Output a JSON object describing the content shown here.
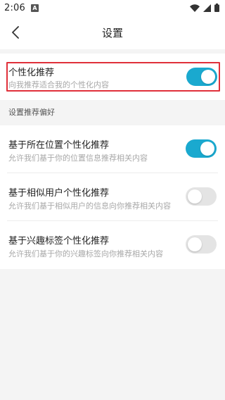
{
  "status_bar": {
    "time": "2:06",
    "notification_letter": "A"
  },
  "header": {
    "title": "设置"
  },
  "top_setting": {
    "title": "个性化推荐",
    "description": "向我推荐适合我的个性化内容",
    "enabled": true
  },
  "section": {
    "label": "设置推荐偏好"
  },
  "preferences": [
    {
      "title": "基于所在位置个性化推荐",
      "description": "允许我们基于你的位置信息推荐相关内容",
      "enabled": true
    },
    {
      "title": "基于相似用户个性化推荐",
      "description": "允许我们基于相似用户的信息向你推荐相关内容",
      "enabled": false
    },
    {
      "title": "基于兴趣标签个性化推荐",
      "description": "允许我们基于你的兴趣标签向你推荐相关内容",
      "enabled": false
    }
  ],
  "colors": {
    "accent": "#1aa9cf",
    "highlight": "#e0303a",
    "toggle_off": "#e4e4e4"
  }
}
